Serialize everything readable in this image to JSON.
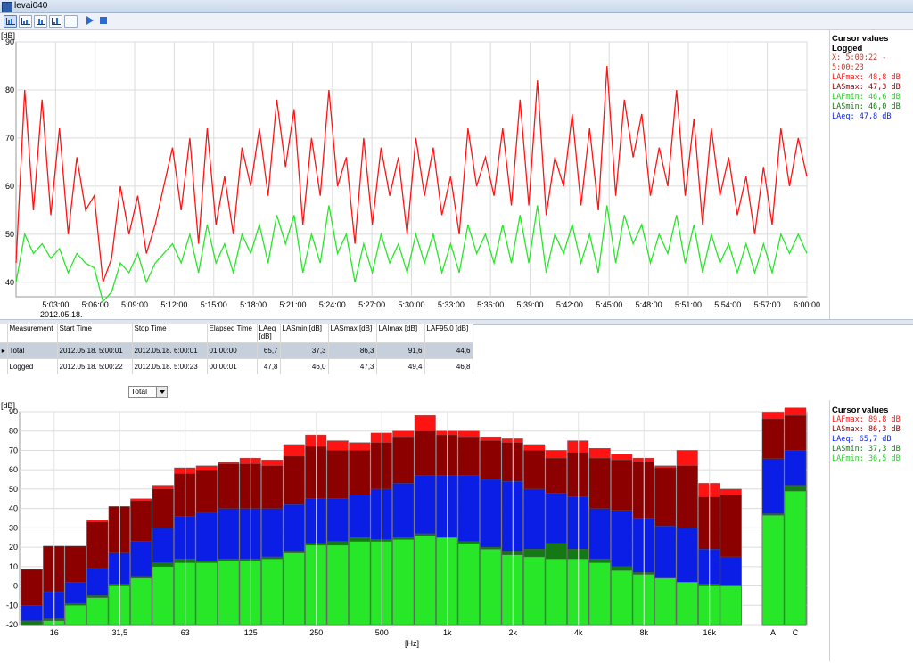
{
  "window": {
    "title": "levai040"
  },
  "colors": {
    "lafmax": "#ff1414",
    "lasmax": "#8c0000",
    "laeq": "#0a1ee6",
    "lasmin": "#147814",
    "lafmin": "#28e628",
    "cursor_x": "#c0392b"
  },
  "toolbar": {
    "icons": [
      "time-history-icon",
      "chart-view-icon",
      "spectrum-icon",
      "statistics-icon",
      "notes-icon",
      "play-icon",
      "stop-icon"
    ]
  },
  "time_chart": {
    "y_unit": "[dB]",
    "y_ticks": [
      "90",
      "80",
      "70",
      "60",
      "50",
      "40"
    ],
    "x_ticks": [
      "5:03:00",
      "5:06:00",
      "5:09:00",
      "5:12:00",
      "5:15:00",
      "5:18:00",
      "5:21:00",
      "5:24:00",
      "5:27:00",
      "5:30:00",
      "5:33:00",
      "5:36:00",
      "5:39:00",
      "5:42:00",
      "5:45:00",
      "5:48:00",
      "5:51:00",
      "5:54:00",
      "5:57:00",
      "6:00:00"
    ],
    "date": "2012.05.18."
  },
  "cursor_top": {
    "title": "Cursor values",
    "subtitle": "Logged",
    "rows": [
      {
        "text": "X: 5:00:22 - 5:00:23",
        "color": "#c0392b"
      },
      {
        "text": "LAFmax: 48,8 dB",
        "color": "#ff1414"
      },
      {
        "text": "LASmax: 47,3 dB",
        "color": "#8c0000"
      },
      {
        "text": "LAFmin: 46,6 dB",
        "color": "#28d028"
      },
      {
        "text": "LASmin: 46,0 dB",
        "color": "#147814"
      },
      {
        "text": "LAeq: 47,8 dB",
        "color": "#0a1ee6"
      }
    ]
  },
  "table": {
    "headers": [
      "Measurement",
      "Start Time",
      "Stop Time",
      "Elapsed Time",
      "LAeq [dB]",
      "LASmin [dB]",
      "LASmax [dB]",
      "LAImax [dB]",
      "LAF95,0 [dB]"
    ],
    "rows": [
      [
        "Total",
        "2012.05.18. 5:00:01",
        "2012.05.18. 6:00:01",
        "01:00:00",
        "65,7",
        "37,3",
        "86,3",
        "91,6",
        "44,6"
      ],
      [
        "Logged",
        "2012.05.18. 5:00:22",
        "2012.05.18. 5:00:23",
        "00:00:01",
        "47,8",
        "46,0",
        "47,3",
        "49,4",
        "46,8"
      ]
    ]
  },
  "selector": {
    "value": "Total"
  },
  "cursor_bottom": {
    "title": "Cursor values",
    "rows": [
      {
        "text": "LAFmax: 89,8 dB",
        "color": "#ff1414"
      },
      {
        "text": "LASmax: 86,3 dB",
        "color": "#8c0000"
      },
      {
        "text": "LAeq: 65,7 dB",
        "color": "#0a1ee6"
      },
      {
        "text": "LASmin: 37,3 dB",
        "color": "#147814"
      },
      {
        "text": "LAFmin: 36,5 dB",
        "color": "#28d028"
      }
    ]
  },
  "chart_data": [
    {
      "type": "line",
      "ylabel": "[dB]",
      "ylim": [
        37,
        90
      ],
      "x_range": [
        "5:00:01",
        "6:00:01"
      ],
      "series": [
        {
          "name": "LAFmax",
          "values": [
            44,
            80,
            55,
            78,
            54,
            72,
            50,
            66,
            55,
            58,
            40,
            45,
            60,
            50,
            58,
            46,
            52,
            60,
            68,
            55,
            70,
            48,
            72,
            52,
            62,
            50,
            68,
            60,
            72,
            58,
            78,
            64,
            76,
            52,
            70,
            58,
            80,
            60,
            66,
            48,
            70,
            52,
            68,
            58,
            66,
            50,
            70,
            58,
            68,
            54,
            62,
            50,
            72,
            60,
            66,
            58,
            72,
            56,
            78,
            56,
            82,
            54,
            66,
            60,
            75,
            56,
            72,
            55,
            85,
            58,
            78,
            66,
            75,
            58,
            68,
            60,
            80,
            58,
            74,
            52,
            72,
            58,
            66,
            54,
            62,
            50,
            64,
            52,
            72,
            60,
            70,
            62
          ]
        },
        {
          "name": "LAFmin",
          "values": [
            40,
            50,
            46,
            48,
            45,
            47,
            42,
            46,
            44,
            43,
            36,
            38,
            44,
            42,
            46,
            40,
            44,
            46,
            48,
            44,
            50,
            42,
            52,
            44,
            48,
            42,
            50,
            46,
            52,
            44,
            54,
            48,
            54,
            42,
            50,
            44,
            56,
            46,
            50,
            40,
            48,
            42,
            50,
            44,
            48,
            42,
            50,
            44,
            50,
            42,
            48,
            42,
            52,
            46,
            50,
            44,
            52,
            44,
            54,
            44,
            56,
            42,
            50,
            46,
            52,
            44,
            50,
            42,
            56,
            44,
            54,
            48,
            52,
            44,
            50,
            46,
            54,
            44,
            52,
            42,
            50,
            44,
            48,
            42,
            48,
            42,
            48,
            42,
            50,
            46,
            50,
            46
          ]
        }
      ]
    },
    {
      "type": "bar",
      "title": "",
      "xlabel": "[Hz]",
      "ylabel": "[dB]",
      "ylim": [
        -20,
        90
      ],
      "categories": [
        "12.5",
        "16",
        "20",
        "25",
        "31,5",
        "40",
        "50",
        "63",
        "80",
        "100",
        "125",
        "160",
        "200",
        "250",
        "315",
        "400",
        "500",
        "630",
        "800",
        "1k",
        "1.25k",
        "1.6k",
        "2k",
        "2.5k",
        "3.15k",
        "4k",
        "5k",
        "6.3k",
        "8k",
        "10k",
        "12.5k",
        "16k",
        "20k"
      ],
      "x_tick_labels": [
        "16",
        "31,5",
        "63",
        "125",
        "250",
        "500",
        "1k",
        "2k",
        "4k",
        "8k",
        "16k"
      ],
      "y_ticks": [
        "90",
        "80",
        "70",
        "60",
        "50",
        "40",
        "30",
        "20",
        "10",
        "0",
        "-10",
        "-20"
      ],
      "series": [
        {
          "name": "LAFmax",
          "values": [
            8.5,
            20.5,
            20.5,
            34,
            41,
            45,
            52,
            61,
            62,
            64,
            66,
            65,
            73,
            78,
            75,
            74,
            79,
            80,
            88,
            80,
            80,
            77,
            76,
            73,
            70,
            75,
            71,
            68,
            66,
            62,
            70,
            53,
            50
          ]
        },
        {
          "name": "LASmax",
          "values": [
            8.5,
            20.5,
            20.5,
            33,
            41,
            44,
            50,
            58,
            60,
            63,
            63,
            62,
            67,
            72,
            70,
            70,
            74,
            77,
            80,
            78,
            77,
            75,
            74,
            70,
            66,
            69,
            66,
            65,
            64,
            61,
            62,
            46,
            47
          ]
        },
        {
          "name": "LAeq",
          "values": [
            -10,
            -3,
            2,
            9,
            17,
            23,
            30,
            36,
            38,
            40,
            40,
            40,
            42,
            45,
            45,
            47,
            50,
            53,
            57,
            57,
            57,
            55,
            54,
            50,
            48,
            46,
            40,
            39,
            35,
            31,
            30,
            19,
            15
          ]
        },
        {
          "name": "LASmin",
          "values": [
            -18,
            -17,
            -9,
            -5,
            1,
            5,
            12,
            14,
            13,
            14,
            14,
            15,
            18,
            22,
            23,
            25,
            24,
            25,
            27,
            25,
            23,
            20,
            18,
            19,
            22,
            19,
            14,
            10,
            7,
            4,
            2,
            1,
            0
          ]
        },
        {
          "name": "LAFmin",
          "values": [
            -20,
            -18,
            -10,
            -6,
            0,
            4,
            10,
            12,
            12,
            13,
            13,
            14,
            17,
            21,
            21,
            23,
            23,
            24,
            26,
            25,
            22,
            19,
            16,
            15,
            14,
            14,
            12,
            8,
            6,
            4,
            2,
            0,
            0
          ]
        }
      ],
      "totals": {
        "categories": [
          "A",
          "C"
        ],
        "LAFmax": [
          89.8,
          92
        ],
        "LASmax": [
          86.3,
          88
        ],
        "LAeq": [
          65.7,
          70
        ],
        "LASmin": [
          37.3,
          52
        ],
        "LAFmin": [
          36.5,
          49
        ]
      }
    }
  ]
}
